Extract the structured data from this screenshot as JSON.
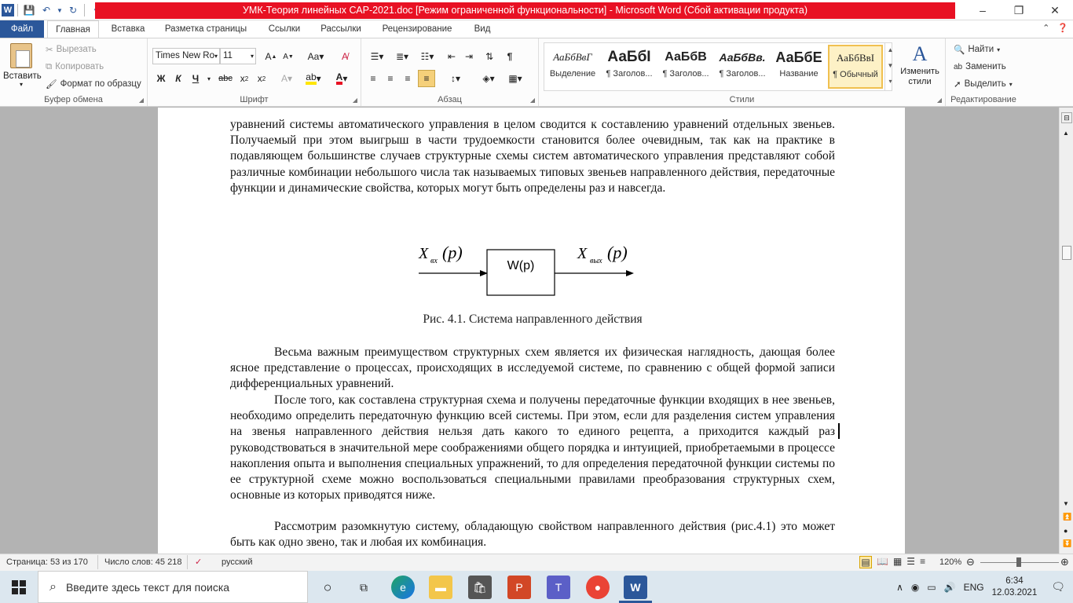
{
  "titlebar": {
    "title": "УМК-Теория линейных САР-2021.doc [Режим ограниченной функциональности]  -  Microsoft Word (Сбой активации продукта)",
    "controls": {
      "minimize": "–",
      "restore": "❐",
      "close": "✕"
    }
  },
  "tabs": [
    "Файл",
    "Главная",
    "Вставка",
    "Разметка страницы",
    "Ссылки",
    "Рассылки",
    "Рецензирование",
    "Вид"
  ],
  "ribbon": {
    "clipboard": {
      "paste": "Вставить",
      "cut": "Вырезать",
      "copy": "Копировать",
      "format_painter": "Формат по образцу",
      "label": "Буфер обмена"
    },
    "font": {
      "name": "Times New Ro",
      "size": "11",
      "label": "Шрифт"
    },
    "paragraph": {
      "label": "Абзац"
    },
    "styles": {
      "items": [
        {
          "sample": "АаБбВвГ",
          "name": "Выделение"
        },
        {
          "sample": "АаБбI",
          "name": "¶ Заголов..."
        },
        {
          "sample": "АаБбВ",
          "name": "¶ Заголов..."
        },
        {
          "sample": "АаБбВв.",
          "name": "¶ Заголов..."
        },
        {
          "sample": "АаБбЕ",
          "name": "Название"
        },
        {
          "sample": "АаБбВвI",
          "name": "¶ Обычный"
        }
      ],
      "change": "Изменить стили",
      "label": "Стили"
    },
    "editing": {
      "find": "Найти",
      "replace": "Заменить",
      "select": "Выделить",
      "label": "Редактирование"
    }
  },
  "document": {
    "p1": "уравнений системы автоматического управления в целом сводится к составлению уравнений отдельных звеньев. Получаемый при этом выигрыш в части трудоемкости становится более очевидным, так как на практике в  подавляющем большинстве случаев структурные схемы систем автоматического управления представляют собой различные комбинации небольшого числа так называемых типовых звеньев направленного действия, передаточные функции и динамические свойства, которых могут быть определены раз и навсегда.",
    "diagram": {
      "input": "X",
      "input_sub": "вх",
      "arg": "(p)",
      "block": "W(p)",
      "output": "X",
      "output_sub": "вых"
    },
    "caption": "Рис. 4.1. Система направленного действия",
    "p2": "Весьма важным преимуществом структурных схем является их физическая наглядность, дающая более ясное представление о процессах, происходящих в исследуемой системе, по сравнению с общей формой записи дифференциальных уравнений.",
    "p3": "После того, как составлена структурная схема и получены передаточные функции входящих в нее звеньев, необходимо определить передаточную функцию всей системы. При этом, если для разделения систем управления на звенья направленного действия нельзя дать какого то единого рецепта, а приходится каждый раз руководствоваться в значительной мере соображениями общего порядка и интуицией, приобретаемыми в процессе накопления опыта и выполнения специальных упражнений, то для определения передаточной функции системы по ее структурной схеме можно воспользоваться специальными правилами преобразования структурных схем, основные из которых приводятся ниже.",
    "p4": "Рассмотрим разомкнутую систему, обладающую свойством направленного действия (рис.4.1) это может быть как одно звено, так и любая их комбинация."
  },
  "statusbar": {
    "page": "Страница: 53 из 170",
    "words": "Число слов: 45 218",
    "lang": "русский",
    "zoom": "120%"
  },
  "taskbar": {
    "search_placeholder": "Введите здесь текст для поиска",
    "lang": "ENG",
    "time": "6:34",
    "date": "12.03.2021"
  }
}
